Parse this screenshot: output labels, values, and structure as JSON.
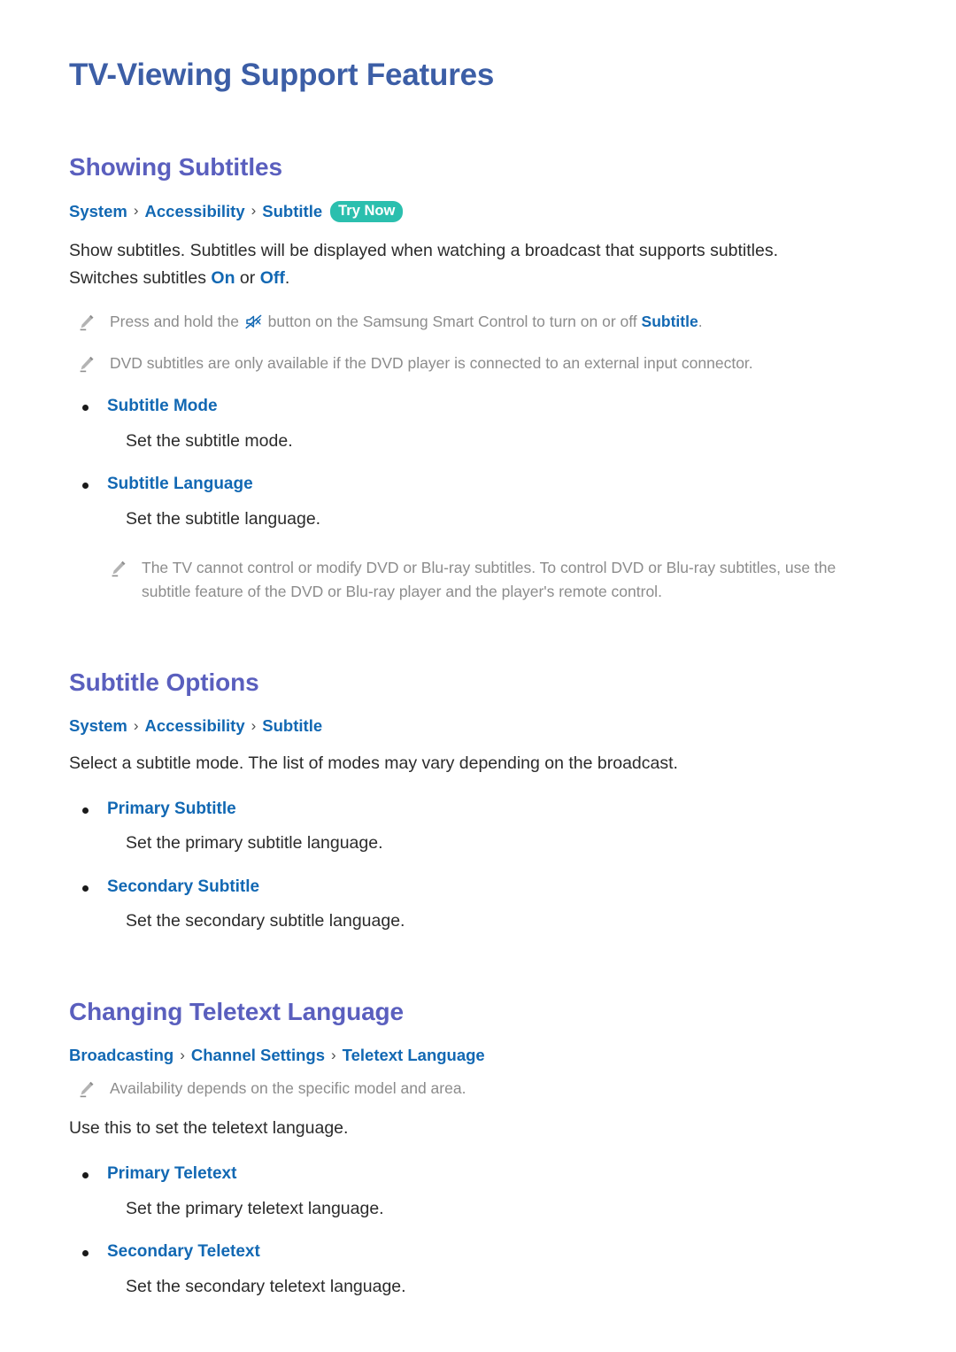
{
  "page": {
    "title": "TV-Viewing Support Features"
  },
  "sections": [
    {
      "heading": "Showing Subtitles",
      "breadcrumb": {
        "crumbs": [
          "System",
          "Accessibility",
          "Subtitle"
        ],
        "separator": "›",
        "badge": "Try Now"
      },
      "intro_line1": "Show subtitles. Subtitles will be displayed when watching a broadcast that supports subtitles.",
      "intro_line2_pre": "Switches subtitles ",
      "intro_on": "On",
      "intro_or": " or ",
      "intro_off": "Off",
      "intro_end": ".",
      "notes": [
        {
          "icon": "pencil-icon",
          "pre": "Press and hold the ",
          "inline_icon": "mute-icon",
          "mid": " button on the Samsung Smart Control to turn on or off ",
          "emphasis": "Subtitle",
          "post": "."
        },
        {
          "icon": "pencil-icon",
          "pre": "DVD subtitles are only available if the DVD player is connected to an external input connector.",
          "inline_icon": null,
          "mid": "",
          "emphasis": "",
          "post": ""
        }
      ],
      "bullets": [
        {
          "label": "Subtitle Mode",
          "desc": "Set the subtitle mode."
        },
        {
          "label": "Subtitle Language",
          "desc": "Set the subtitle language."
        }
      ],
      "trailing_note": {
        "icon": "pencil-icon",
        "text": "The TV cannot control or modify DVD or Blu-ray subtitles. To control DVD or Blu-ray subtitles, use the subtitle feature of the DVD or Blu-ray player and the player's remote control."
      }
    },
    {
      "heading": "Subtitle Options",
      "breadcrumb": {
        "crumbs": [
          "System",
          "Accessibility",
          "Subtitle"
        ],
        "separator": "›",
        "badge": null
      },
      "intro_line1": "Select a subtitle mode. The list of modes may vary depending on the broadcast.",
      "bullets": [
        {
          "label": "Primary Subtitle",
          "desc": "Set the primary subtitle language."
        },
        {
          "label": "Secondary Subtitle",
          "desc": "Set the secondary subtitle language."
        }
      ]
    },
    {
      "heading": "Changing Teletext Language",
      "breadcrumb": {
        "crumbs": [
          "Broadcasting",
          "Channel Settings",
          "Teletext Language"
        ],
        "separator": "›",
        "badge": null
      },
      "note": {
        "icon": "pencil-icon",
        "text": "Availability depends on the specific model and area."
      },
      "intro_line1": "Use this to set the teletext language.",
      "bullets": [
        {
          "label": "Primary Teletext",
          "desc": "Set the primary teletext language."
        },
        {
          "label": "Secondary Teletext",
          "desc": "Set the secondary teletext language."
        }
      ]
    }
  ],
  "colors": {
    "page_title": "#3c5ea6",
    "section_heading": "#5a5fbe",
    "link_blue": "#1268b3",
    "badge_teal": "#2bbfae",
    "note_gray": "#8c8c8c",
    "body": "#2b2b2b"
  }
}
